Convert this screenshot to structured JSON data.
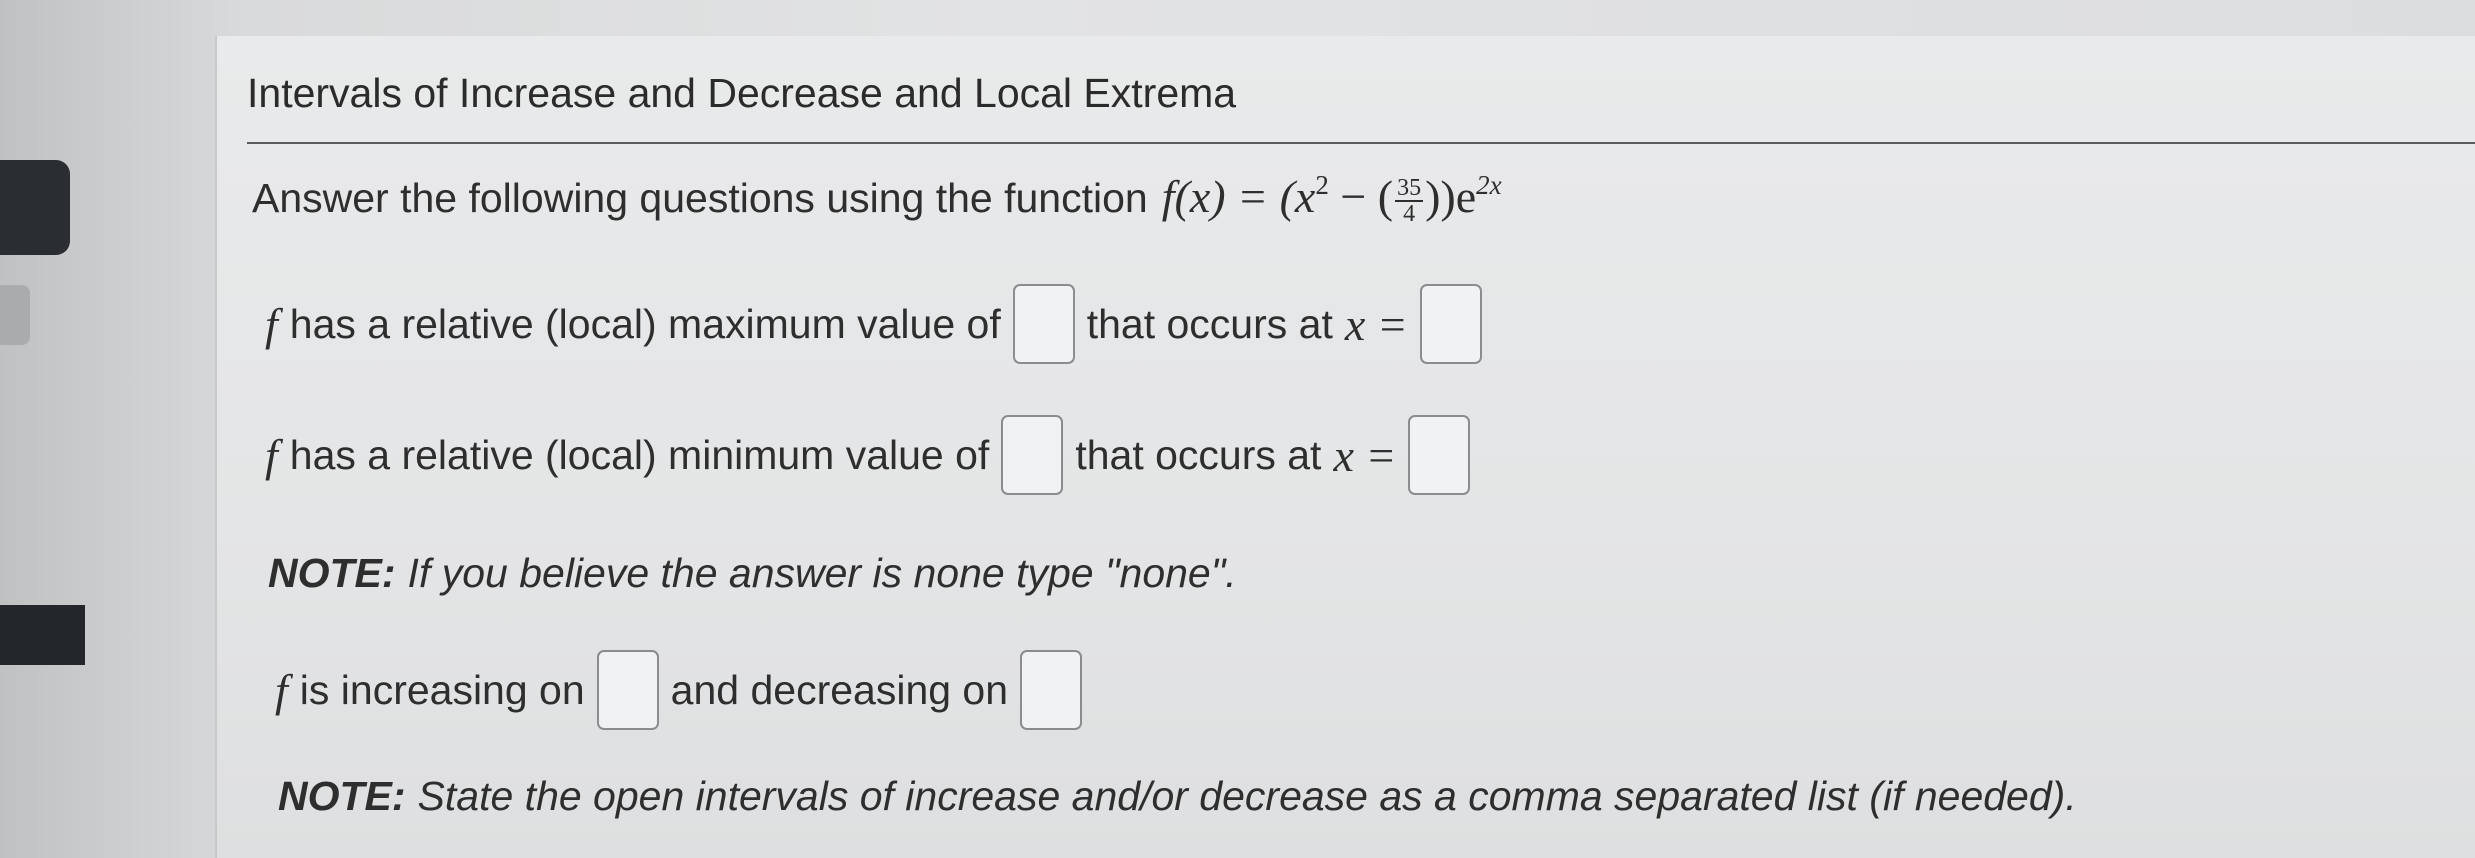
{
  "title": "Intervals of Increase and Decrease and Local Extrema",
  "prompt": {
    "text": "Answer the following questions using the function",
    "function_label": "f(x) = (x",
    "exp2": "2",
    "minus_paren": " − (",
    "frac_num": "35",
    "frac_den": "4",
    "close": "))e",
    "exp_2x": "2x"
  },
  "max_line": {
    "f": "f",
    "text1": "has a relative (local) maximum value of",
    "text2": "that occurs at",
    "x_eq": "x ="
  },
  "min_line": {
    "f": "f",
    "text1": "has a relative (local) minimum value of",
    "text2": "that occurs at",
    "x_eq": "x ="
  },
  "note1": {
    "label": "NOTE:",
    "text": "If you believe the answer is none type \"none\"."
  },
  "inc_line": {
    "f": "f",
    "text1": "is increasing on",
    "text2": "and decreasing on"
  },
  "note2": {
    "label": "NOTE:",
    "text": "State the open intervals of increase and/or decrease as a comma separated list (if needed)."
  }
}
